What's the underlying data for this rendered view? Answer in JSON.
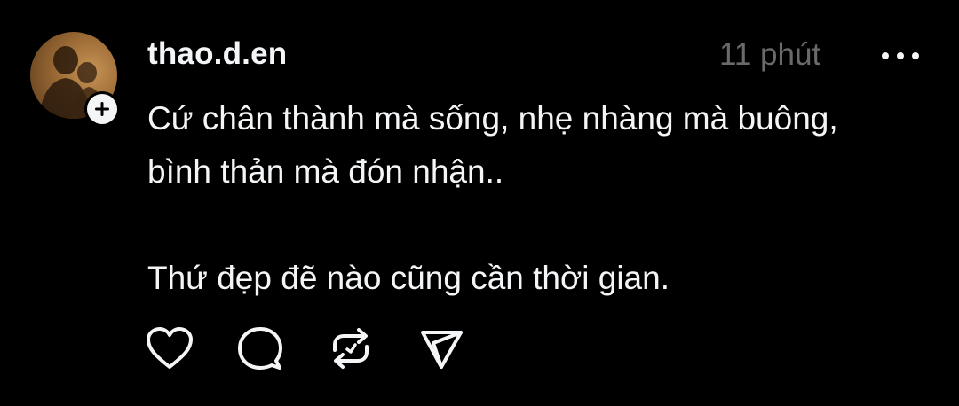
{
  "post": {
    "username": "thao.d.en",
    "timestamp": "11 phút",
    "caption_lines": [
      "Cứ chân thành mà sống, nhẹ nhàng mà buông,",
      "bình thản mà đón nhận..",
      "Thứ đẹp đẽ nào cũng cần thời gian."
    ]
  },
  "icons": {
    "avatar": "profile-photo",
    "follow": "plus-icon",
    "more": "more-horizontal-icon",
    "like": "heart-icon",
    "comment": "comment-bubble-icon",
    "repost": "repost-icon",
    "share": "send-icon"
  },
  "colors": {
    "background": "#000000",
    "primary_text": "#f3f5f7",
    "secondary_text": "#6a6a6a"
  }
}
